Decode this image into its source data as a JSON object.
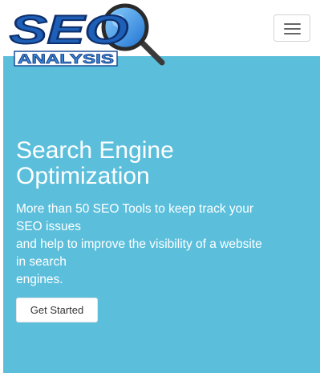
{
  "brand": {
    "logo_main": "SEO",
    "logo_sub": "ANALYSIS"
  },
  "navbar": {
    "menu_icon": "hamburger-menu-icon"
  },
  "hero": {
    "title_line1": "Search Engine",
    "title_line2": "Optimization",
    "desc_line1": "More than 50 SEO Tools to keep track your",
    "desc_line2": "SEO issues",
    "desc_line3": "and help to improve the visibility of a website",
    "desc_line4": "in search",
    "desc_line5": "engines.",
    "cta_label": "Get Started"
  },
  "colors": {
    "hero_background": "#5bbfdc",
    "logo_blue": "#1e5fb8",
    "logo_dark_blue": "#123f86",
    "logo_sub_blue": "#3f86d6"
  }
}
